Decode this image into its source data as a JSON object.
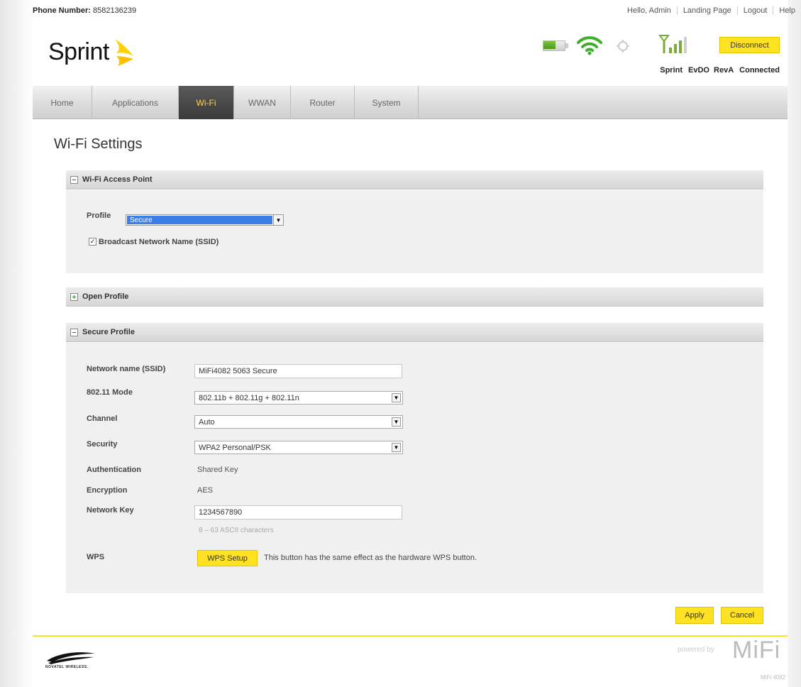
{
  "header": {
    "phone_label": "Phone Number:",
    "phone_number": "8582136239",
    "greeting": "Hello, Admin",
    "links": [
      "Landing Page",
      "Logout",
      "Help"
    ]
  },
  "brand": {
    "logo_text": "Sprint",
    "logo_color": "#ffd100"
  },
  "status": {
    "disconnect_label": "Disconnect",
    "carrier": "Sprint",
    "network": "EvDO RevA",
    "connection": "Connected",
    "battery_level": 0.55
  },
  "nav": {
    "tabs": [
      "Home",
      "Applications",
      "Wi-Fi",
      "WWAN",
      "Router",
      "System"
    ],
    "active": "Wi-Fi"
  },
  "page": {
    "title": "Wi-Fi Settings"
  },
  "access_point": {
    "section_title": "Wi-Fi Access Point",
    "profile_label": "Profile",
    "profile_value": "Secure",
    "broadcast_label": "Broadcast Network Name (SSID)",
    "broadcast_checked": true,
    "broadcast_mark": "✓"
  },
  "open_profile": {
    "section_title": "Open Profile"
  },
  "secure_profile": {
    "section_title": "Secure Profile",
    "ssid_label": "Network name (SSID)",
    "ssid_value": "MiFi4082 5063 Secure",
    "mode_label": "802.11 Mode",
    "mode_value": "802.11b + 802.11g + 802.11n",
    "channel_label": "Channel",
    "channel_value": "Auto",
    "security_label": "Security",
    "security_value": "WPA2 Personal/PSK",
    "auth_label": "Authentication",
    "auth_value": "Shared Key",
    "encryption_label": "Encryption",
    "encryption_value": "AES",
    "key_label": "Network Key",
    "key_value": "1234567890",
    "key_hint": "8 – 63 ASCII characters",
    "wps_label": "WPS",
    "wps_button": "WPS Setup",
    "wps_description": "This button has the same effect as the hardware WPS button."
  },
  "actions": {
    "apply": "Apply",
    "cancel": "Cancel"
  },
  "footer": {
    "left_logo_text": "NOVATEL WIRELESS.",
    "powered_by": "powered by",
    "mifi": "MiFi",
    "mifi_model": "MiFi 4082"
  },
  "colors": {
    "accent_yellow": "#ffe221",
    "active_tab": "#404040"
  }
}
